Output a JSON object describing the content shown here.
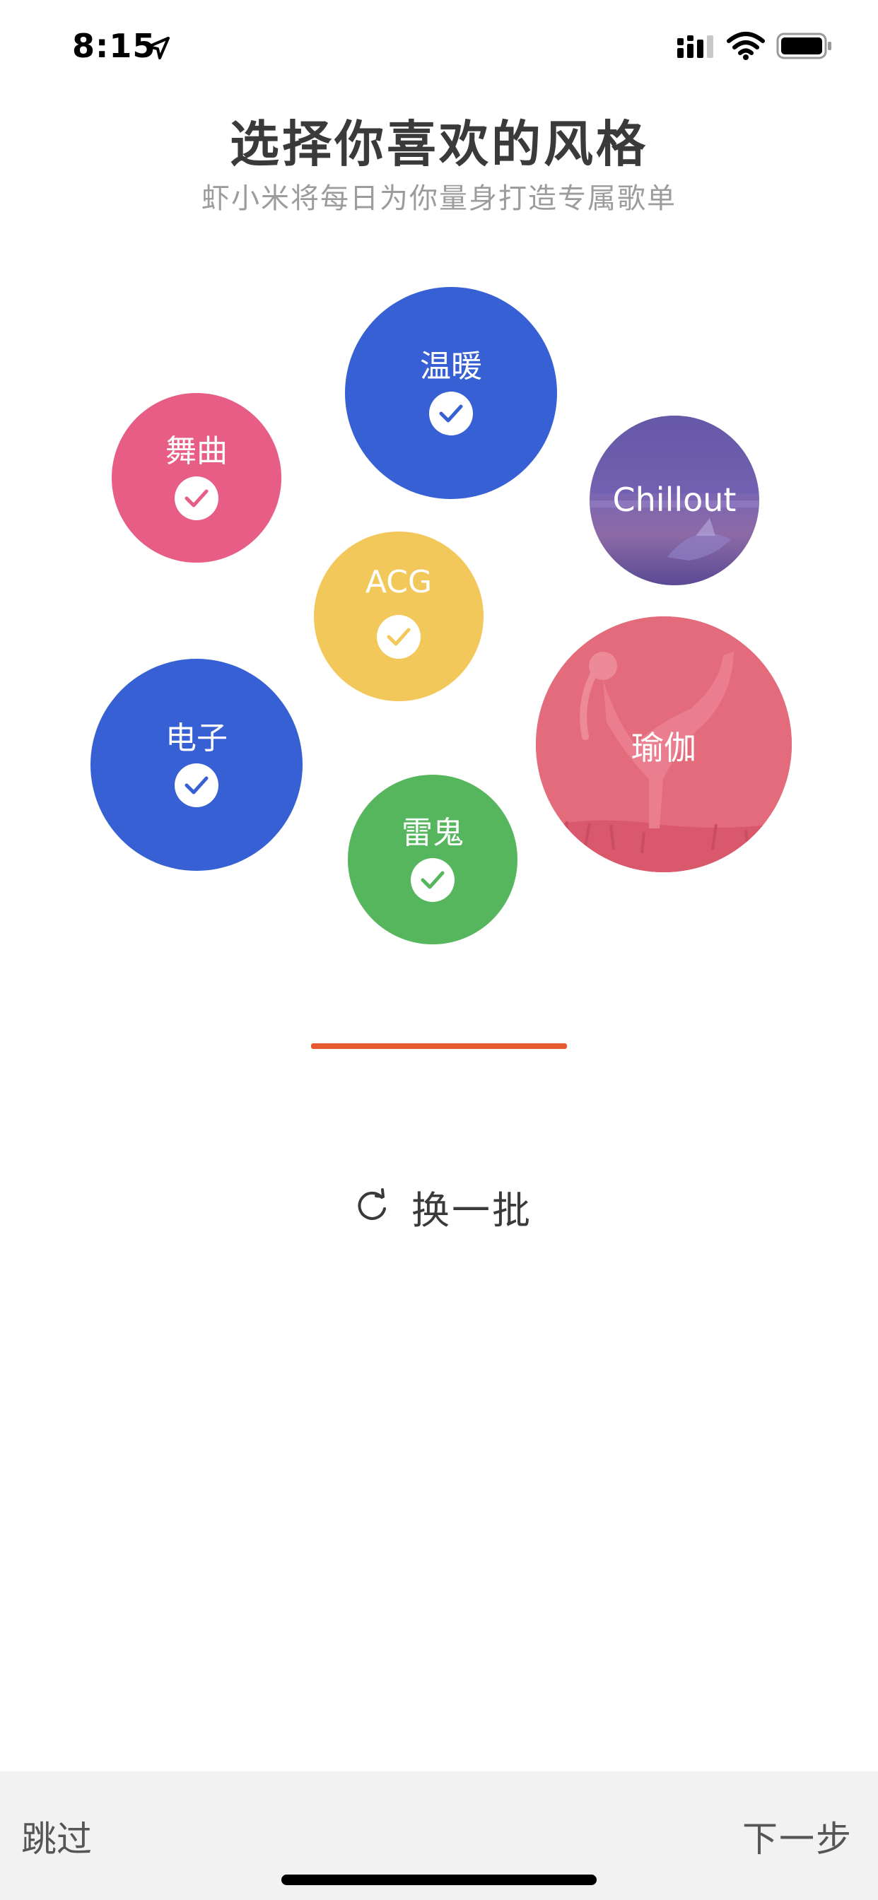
{
  "status_bar": {
    "time": "8:15",
    "icons": [
      "location-arrow-icon",
      "cellular-signal-icon",
      "wifi-icon",
      "battery-icon"
    ]
  },
  "header": {
    "title": "选择你喜欢的风格",
    "subtitle": "虾小米将每日为你量身打造专属歌单"
  },
  "styles": [
    {
      "label": "温暖",
      "selected": true,
      "color": "#3760d4"
    },
    {
      "label": "舞曲",
      "selected": true,
      "color": "#e85d86"
    },
    {
      "label": "Chillout",
      "selected": false,
      "color": "#6a5aa8"
    },
    {
      "label": "ACG",
      "selected": true,
      "color": "#f3c85a"
    },
    {
      "label": "电子",
      "selected": true,
      "color": "#3760d4"
    },
    {
      "label": "瑜伽",
      "selected": false,
      "color": "#e06477"
    },
    {
      "label": "雷鬼",
      "selected": true,
      "color": "#56b65d"
    }
  ],
  "progress": {
    "fraction": 1.0,
    "color": "#e55a2e"
  },
  "refresh": {
    "label": "换一批",
    "icon": "refresh-icon"
  },
  "bottom_bar": {
    "skip_label": "跳过",
    "next_label": "下一步"
  }
}
